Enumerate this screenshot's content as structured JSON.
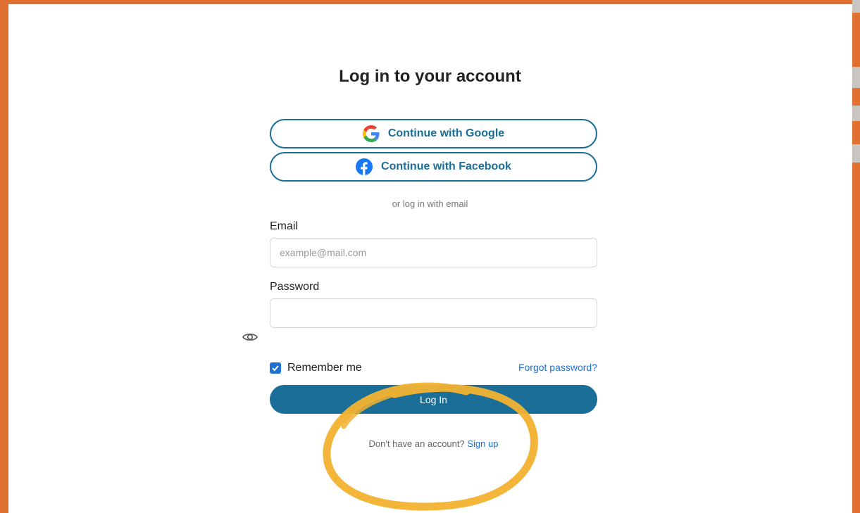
{
  "page": {
    "title": "Log in to your account",
    "colors": {
      "background": "#e0702f",
      "accent": "#1a6e97",
      "link": "#1e6fd6",
      "highlight": "#f2b230"
    }
  },
  "social": {
    "google": {
      "label": "Continue with Google",
      "icon": "google-icon"
    },
    "facebook": {
      "label": "Continue with Facebook",
      "icon": "facebook-icon"
    }
  },
  "divider": {
    "text": "or log in with email"
  },
  "email": {
    "label": "Email",
    "placeholder": "example@mail.com",
    "value": ""
  },
  "password": {
    "label": "Password",
    "value": "",
    "toggle_icon": "eye-icon"
  },
  "remember": {
    "label": "Remember me",
    "checked": true
  },
  "forgot": {
    "label": "Forgot password?"
  },
  "login": {
    "label": "Log In"
  },
  "signup": {
    "prompt": "Don't have an account?",
    "link": "Sign up"
  }
}
